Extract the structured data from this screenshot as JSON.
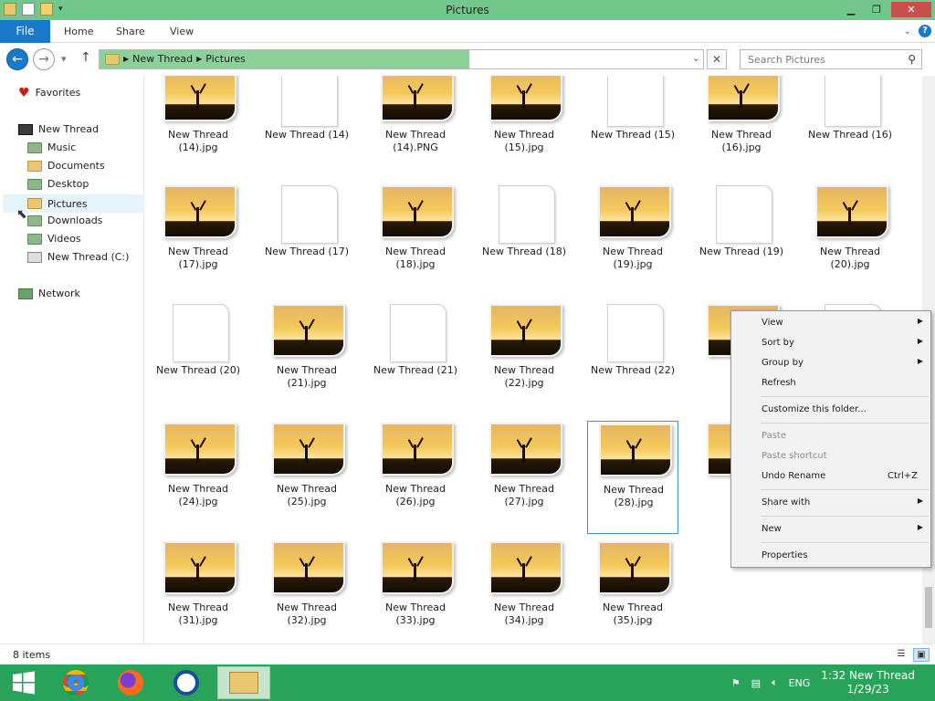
{
  "window": {
    "title": "Pictures"
  },
  "ribbon": {
    "file": "File",
    "tabs": [
      "Home",
      "Share",
      "View"
    ],
    "help_icon": "question-icon"
  },
  "address": {
    "breadcrumbs": [
      "New Thread",
      "Pictures"
    ],
    "search_placeholder": "Search Pictures"
  },
  "nav": {
    "favorites": "Favorites",
    "this_pc": "New Thread",
    "items": [
      "Music",
      "Documents",
      "Desktop",
      "Pictures",
      "Downloads",
      "Videos",
      "New Thread (C:)"
    ],
    "selected": "Pictures",
    "network": "Network"
  },
  "files": [
    {
      "line1": "New Thread",
      "line2": "(14).jpg",
      "type": "photo"
    },
    {
      "line1": "New Thread (14)",
      "line2": "",
      "type": "blank"
    },
    {
      "line1": "New Thread",
      "line2": "(14).PNG",
      "type": "photo"
    },
    {
      "line1": "New Thread",
      "line2": "(15).jpg",
      "type": "photo"
    },
    {
      "line1": "New Thread (15)",
      "line2": "",
      "type": "blank"
    },
    {
      "line1": "New Thread",
      "line2": "(16).jpg",
      "type": "photo"
    },
    {
      "line1": "New Thread (16)",
      "line2": "",
      "type": "blank"
    },
    {
      "line1": "New Thread",
      "line2": "(17).jpg",
      "type": "photo"
    },
    {
      "line1": "New Thread (17)",
      "line2": "",
      "type": "blank"
    },
    {
      "line1": "New Thread",
      "line2": "(18).jpg",
      "type": "photo"
    },
    {
      "line1": "New Thread (18)",
      "line2": "",
      "type": "blank"
    },
    {
      "line1": "New Thread",
      "line2": "(19).jpg",
      "type": "photo"
    },
    {
      "line1": "New Thread (19)",
      "line2": "",
      "type": "blank"
    },
    {
      "line1": "New Thread",
      "line2": "(20).jpg",
      "type": "photo"
    },
    {
      "line1": "New Thread (20)",
      "line2": "",
      "type": "blank"
    },
    {
      "line1": "New Thread",
      "line2": "(21).jpg",
      "type": "photo"
    },
    {
      "line1": "New Thread (21)",
      "line2": "",
      "type": "blank"
    },
    {
      "line1": "New Thread",
      "line2": "(22).jpg",
      "type": "photo"
    },
    {
      "line1": "New Thread (22)",
      "line2": "",
      "type": "blank"
    },
    {
      "line1": "Ne",
      "line2": "",
      "type": "photo"
    },
    {
      "line1": "",
      "line2": "",
      "type": "blank"
    },
    {
      "line1": "New Thread",
      "line2": "(24).jpg",
      "type": "photo"
    },
    {
      "line1": "New Thread",
      "line2": "(25).jpg",
      "type": "photo"
    },
    {
      "line1": "New Thread",
      "line2": "(26).jpg",
      "type": "photo"
    },
    {
      "line1": "New Thread",
      "line2": "(27).jpg",
      "type": "photo"
    },
    {
      "line1": "New Thread",
      "line2": "(28).jpg",
      "type": "photo",
      "selected": true
    },
    {
      "line1": "Ne",
      "line2": "",
      "type": "photo"
    },
    {
      "line1": "",
      "line2": "",
      "type": "none"
    },
    {
      "line1": "New Thread",
      "line2": "(31).jpg",
      "type": "photo"
    },
    {
      "line1": "New Thread",
      "line2": "(32).jpg",
      "type": "photo"
    },
    {
      "line1": "New Thread",
      "line2": "(33).jpg",
      "type": "photo"
    },
    {
      "line1": "New Thread",
      "line2": "(34).jpg",
      "type": "photo"
    },
    {
      "line1": "New Thread",
      "line2": "(35).jpg",
      "type": "photo"
    }
  ],
  "status": {
    "count": "8 items"
  },
  "context_menu": [
    {
      "label": "View",
      "submenu": true
    },
    {
      "label": "Sort by",
      "submenu": true
    },
    {
      "label": "Group by",
      "submenu": true
    },
    {
      "label": "Refresh"
    },
    {
      "sep": true
    },
    {
      "label": "Customize this folder..."
    },
    {
      "sep": true
    },
    {
      "label": "Paste",
      "disabled": true
    },
    {
      "label": "Paste shortcut",
      "disabled": true
    },
    {
      "label": "Undo Rename",
      "shortcut": "Ctrl+Z"
    },
    {
      "sep": true
    },
    {
      "label": "Share with",
      "submenu": true
    },
    {
      "sep": true
    },
    {
      "label": "New",
      "submenu": true
    },
    {
      "sep": true
    },
    {
      "label": "Properties"
    }
  ],
  "taskbar": {
    "lang": "ENG",
    "time": "1:32 New Thread",
    "date": "1/29/23"
  },
  "colors": {
    "title_green": "#73c68c",
    "taskbar_green": "#2aa35a",
    "accent_blue": "#1979ca"
  }
}
